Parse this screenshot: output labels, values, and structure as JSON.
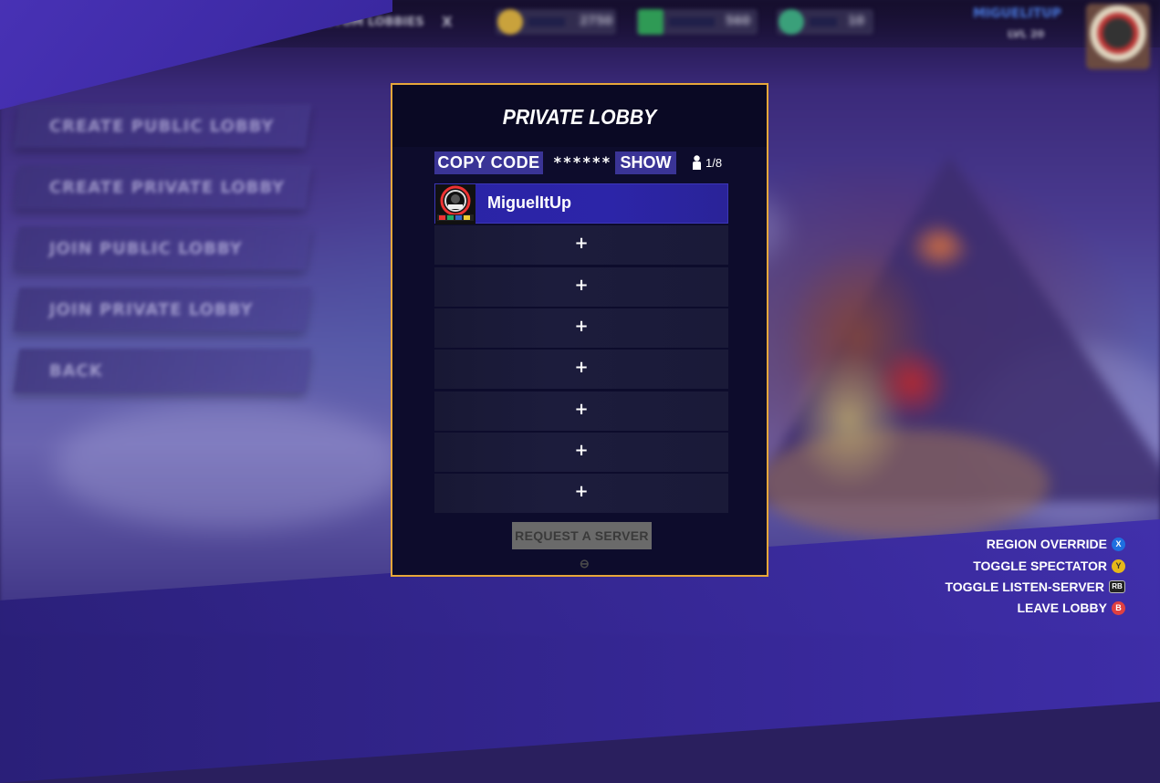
{
  "background": {
    "top_bar": {
      "region_label": "CUSTOM LOBBIES",
      "region_close": "X",
      "currencies": [
        {
          "icon": "gold-coin-icon",
          "value": "2750",
          "color": "#c9a23c"
        },
        {
          "icon": "green-cash-icon",
          "value": "560",
          "color": "#2f9a55"
        },
        {
          "icon": "emerald-gem-icon",
          "value": "10",
          "color": "#3aa07a"
        }
      ],
      "username": "MIGUELITUP",
      "player_level": "LVL 20"
    },
    "menu": [
      "CREATE PUBLIC LOBBY",
      "CREATE PRIVATE LOBBY",
      "JOIN PUBLIC LOBBY",
      "JOIN PRIVATE LOBBY",
      "BACK"
    ]
  },
  "lobby": {
    "title": "PRIVATE LOBBY",
    "copy_code_label": "COPY CODE",
    "code_masked": "******",
    "show_label": "SHOW",
    "player_count": "1/8",
    "slots": [
      {
        "name": "MiguelItUp",
        "filled": true
      },
      {
        "name": "+",
        "filled": false
      },
      {
        "name": "+",
        "filled": false
      },
      {
        "name": "+",
        "filled": false
      },
      {
        "name": "+",
        "filled": false
      },
      {
        "name": "+",
        "filled": false
      },
      {
        "name": "+",
        "filled": false
      },
      {
        "name": "+",
        "filled": false
      }
    ],
    "request_server_label": "REQUEST A SERVER",
    "request_server_glyph": "⊖"
  },
  "hints": [
    {
      "label": "REGION OVERRIDE",
      "button": "X",
      "color": "#1e6fe0",
      "icon": "x-button-icon"
    },
    {
      "label": "TOGGLE SPECTATOR",
      "button": "Y",
      "color": "#e6b81a",
      "icon": "y-button-icon"
    },
    {
      "label": "TOGGLE LISTEN-SERVER",
      "button": "RB",
      "color": "#222222",
      "icon": "rb-button-icon"
    },
    {
      "label": "LEAVE LOBBY",
      "button": "B",
      "color": "#e04040",
      "icon": "b-button-icon"
    }
  ]
}
